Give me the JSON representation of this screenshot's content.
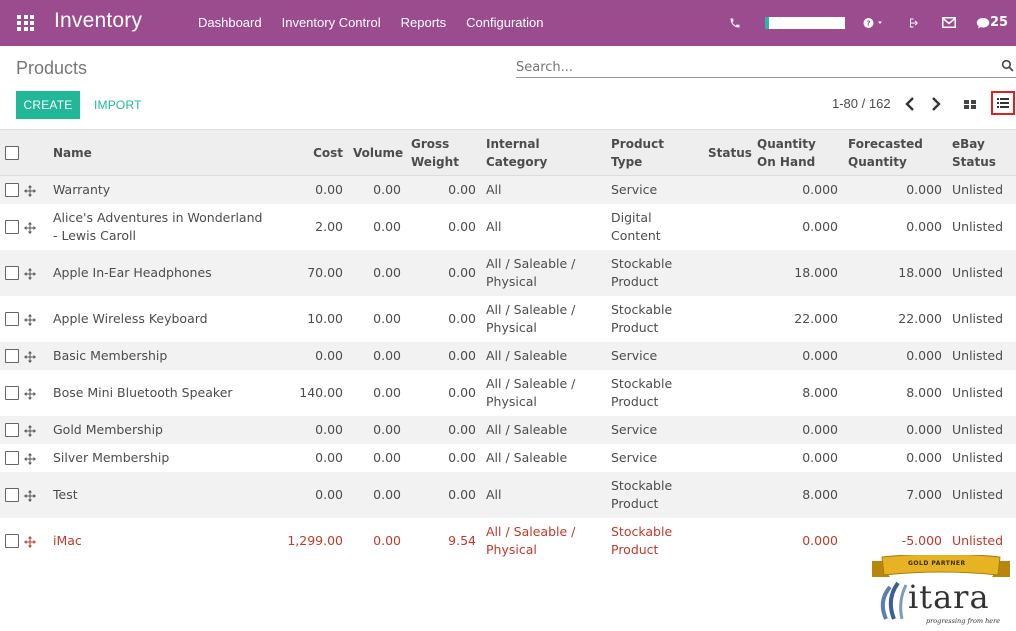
{
  "topbar": {
    "app_name": "Inventory",
    "nav": [
      "Dashboard",
      "Inventory Control",
      "Reports",
      "Configuration"
    ],
    "chat_count": "25",
    "accent": "#9b4c8e"
  },
  "control": {
    "title": "Products",
    "search_placeholder": "Search...",
    "create_label": "CREATE",
    "import_label": "IMPORT",
    "pager": "1-80 / 162"
  },
  "table": {
    "headers": {
      "name": "Name",
      "cost": "Cost",
      "volume": "Volume",
      "gross_weight": "Gross Weight",
      "category": "Internal Category",
      "type": "Product Type",
      "status": "Status",
      "qty": "Quantity On Hand",
      "forecast": "Forecasted Quantity",
      "ebay": "eBay Status"
    },
    "rows": [
      {
        "name": "Warranty",
        "cost": "0.00",
        "volume": "0.00",
        "weight": "0.00",
        "category": "All",
        "type": "Service",
        "status": "",
        "qty": "0.000",
        "forecast": "0.000",
        "ebay": "Unlisted",
        "red": false
      },
      {
        "name": "Alice's Adventures in Wonderland - Lewis Caroll",
        "cost": "2.00",
        "volume": "0.00",
        "weight": "0.00",
        "category": "All",
        "type": "Digital Content",
        "status": "",
        "qty": "0.000",
        "forecast": "0.000",
        "ebay": "Unlisted",
        "red": false
      },
      {
        "name": "Apple In-Ear Headphones",
        "cost": "70.00",
        "volume": "0.00",
        "weight": "0.00",
        "category": "All / Saleable / Physical",
        "type": "Stockable Product",
        "status": "",
        "qty": "18.000",
        "forecast": "18.000",
        "ebay": "Unlisted",
        "red": false
      },
      {
        "name": "Apple Wireless Keyboard",
        "cost": "10.00",
        "volume": "0.00",
        "weight": "0.00",
        "category": "All / Saleable / Physical",
        "type": "Stockable Product",
        "status": "",
        "qty": "22.000",
        "forecast": "22.000",
        "ebay": "Unlisted",
        "red": false
      },
      {
        "name": "Basic Membership",
        "cost": "0.00",
        "volume": "0.00",
        "weight": "0.00",
        "category": "All / Saleable",
        "type": "Service",
        "status": "",
        "qty": "0.000",
        "forecast": "0.000",
        "ebay": "Unlisted",
        "red": false
      },
      {
        "name": "Bose Mini Bluetooth Speaker",
        "cost": "140.00",
        "volume": "0.00",
        "weight": "0.00",
        "category": "All / Saleable / Physical",
        "type": "Stockable Product",
        "status": "",
        "qty": "8.000",
        "forecast": "8.000",
        "ebay": "Unlisted",
        "red": false
      },
      {
        "name": "Gold Membership",
        "cost": "0.00",
        "volume": "0.00",
        "weight": "0.00",
        "category": "All / Saleable",
        "type": "Service",
        "status": "",
        "qty": "0.000",
        "forecast": "0.000",
        "ebay": "Unlisted",
        "red": false
      },
      {
        "name": "Silver Membership",
        "cost": "0.00",
        "volume": "0.00",
        "weight": "0.00",
        "category": "All / Saleable",
        "type": "Service",
        "status": "",
        "qty": "0.000",
        "forecast": "0.000",
        "ebay": "Unlisted",
        "red": false
      },
      {
        "name": "Test",
        "cost": "0.00",
        "volume": "0.00",
        "weight": "0.00",
        "category": "All",
        "type": "Stockable Product",
        "status": "",
        "qty": "8.000",
        "forecast": "7.000",
        "ebay": "Unlisted",
        "red": false
      },
      {
        "name": "iMac",
        "cost": "1,299.00",
        "volume": "0.00",
        "weight": "9.54",
        "category": "All / Saleable / Physical",
        "type": "Stockable Product",
        "status": "",
        "qty": "0.000",
        "forecast": "-5.000",
        "ebay": "Unlisted",
        "red": true
      }
    ]
  },
  "logo": {
    "ribbon": "GOLD PARTNER",
    "word": "itara",
    "tagline": "progressing from here"
  }
}
